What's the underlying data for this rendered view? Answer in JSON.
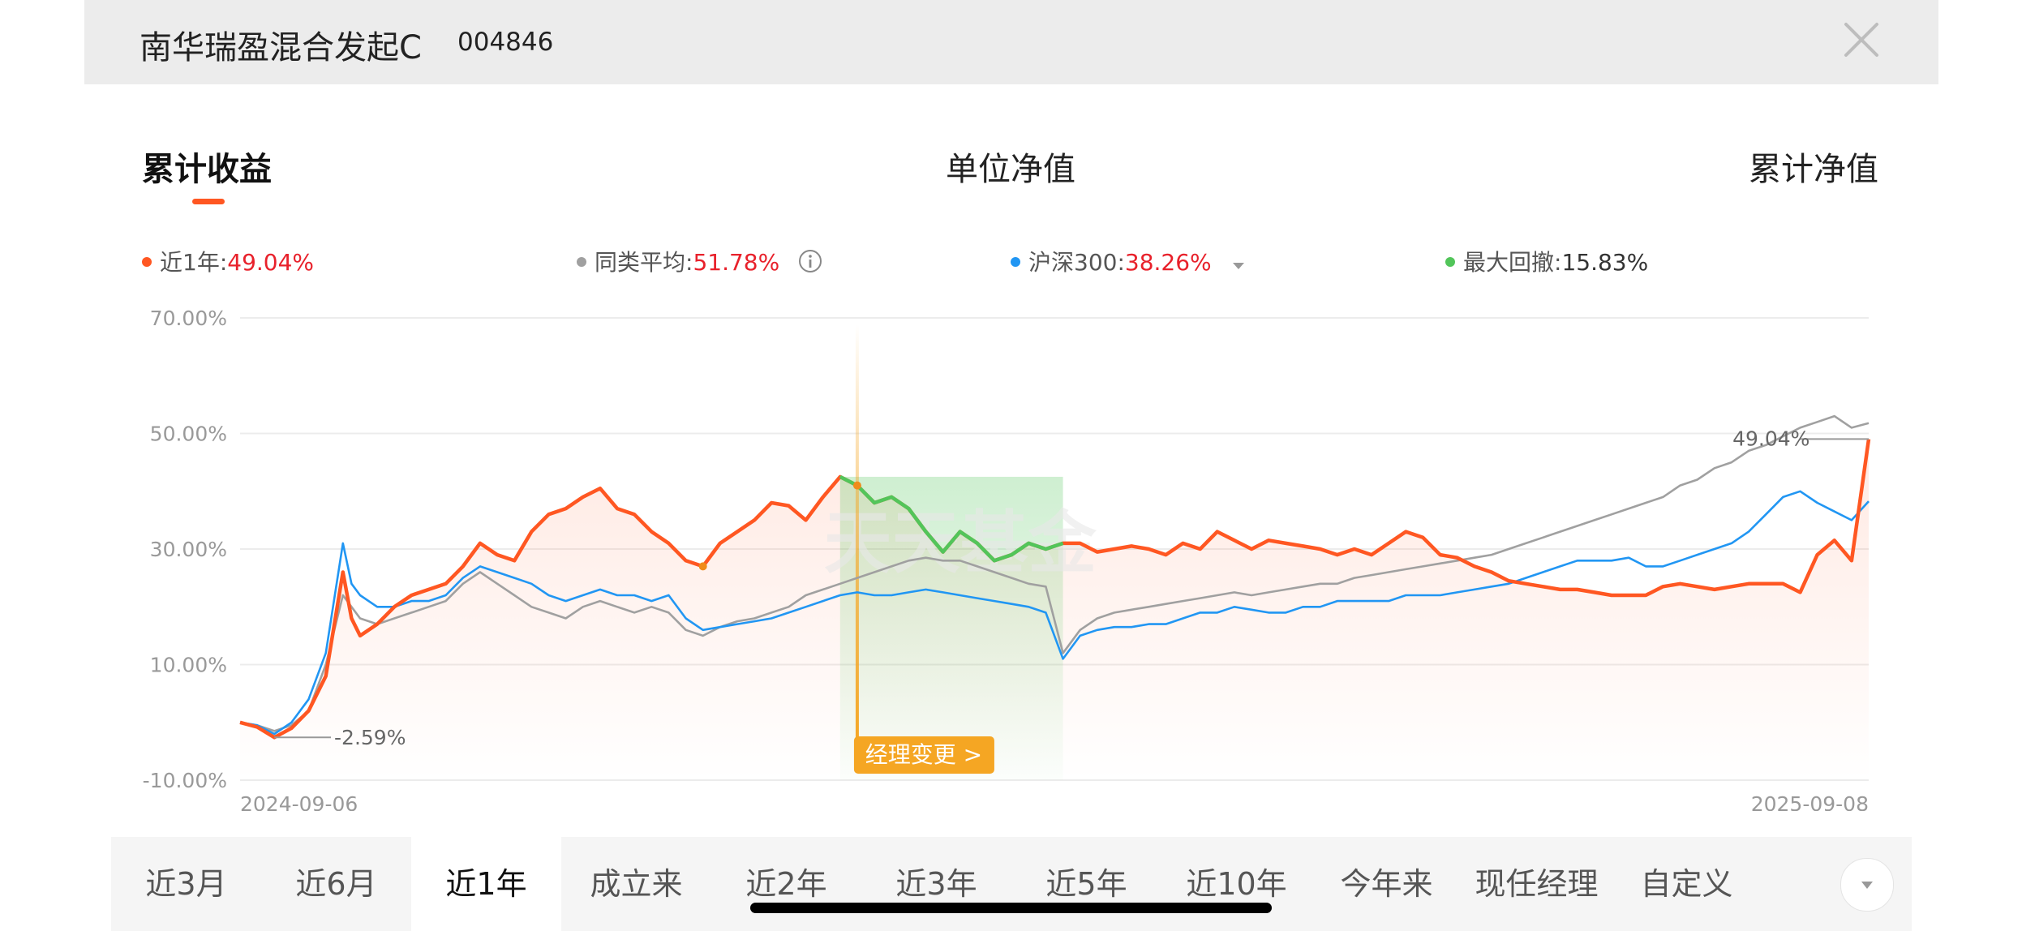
{
  "header": {
    "fund_name": "南华瑞盈混合发起C",
    "fund_code": "004846"
  },
  "tabs": [
    {
      "label": "累计收益",
      "active": true
    },
    {
      "label": "单位净值",
      "active": false
    },
    {
      "label": "累计净值",
      "active": false
    }
  ],
  "legend": [
    {
      "label": "近1年:",
      "value": "49.04%",
      "color": "#ff5722"
    },
    {
      "label": "同类平均:",
      "value": "51.78%",
      "color": "#a0a0a0"
    },
    {
      "label": "沪深300:",
      "value": "38.26%",
      "color": "#2196f3"
    },
    {
      "label": "最大回撤:",
      "value": "15.83%",
      "color": "#52c55a"
    }
  ],
  "chart_data": {
    "type": "line",
    "x_start": "2024-09-06",
    "x_end": "2025-09-08",
    "ylim": [
      -10,
      70
    ],
    "y_ticks": [
      "70.00%",
      "50.00%",
      "30.00%",
      "10.00%",
      "-10.00%"
    ],
    "x_tick_labels": [
      "2024-09-06",
      "2025-09-08"
    ],
    "grid": true,
    "series": [
      {
        "name": "近1年",
        "color": "#ff5722",
        "points": [
          [
            0,
            0
          ],
          [
            1,
            -0.8
          ],
          [
            2,
            -2.6
          ],
          [
            3,
            -1
          ],
          [
            4,
            2
          ],
          [
            5,
            8
          ],
          [
            6,
            26
          ],
          [
            6.5,
            18
          ],
          [
            7,
            15
          ],
          [
            8,
            17
          ],
          [
            9,
            20
          ],
          [
            10,
            22
          ],
          [
            11,
            23
          ],
          [
            12,
            24
          ],
          [
            13,
            27
          ],
          [
            14,
            31
          ],
          [
            15,
            29
          ],
          [
            16,
            28
          ],
          [
            17,
            33
          ],
          [
            18,
            36
          ],
          [
            19,
            37
          ],
          [
            20,
            39
          ],
          [
            21,
            40.5
          ],
          [
            22,
            37
          ],
          [
            23,
            36
          ],
          [
            24,
            33
          ],
          [
            25,
            31
          ],
          [
            26,
            28
          ],
          [
            27,
            27
          ],
          [
            28,
            31
          ],
          [
            29,
            33
          ],
          [
            30,
            35
          ],
          [
            31,
            38
          ],
          [
            32,
            37.5
          ],
          [
            33,
            35
          ],
          [
            34,
            39
          ],
          [
            35,
            42.5
          ],
          [
            36,
            41
          ],
          [
            37,
            38
          ],
          [
            38,
            39
          ],
          [
            39,
            37
          ],
          [
            40,
            33
          ],
          [
            41,
            29.5
          ],
          [
            42,
            33
          ],
          [
            43,
            31
          ],
          [
            44,
            28
          ],
          [
            45,
            29
          ],
          [
            46,
            31
          ],
          [
            47,
            30
          ],
          [
            48,
            31
          ],
          [
            49,
            31
          ],
          [
            50,
            29.5
          ],
          [
            51,
            30
          ],
          [
            52,
            30.5
          ],
          [
            53,
            30
          ],
          [
            54,
            29
          ],
          [
            55,
            31
          ],
          [
            56,
            30
          ],
          [
            57,
            33
          ],
          [
            58,
            31.5
          ],
          [
            59,
            30
          ],
          [
            60,
            31.5
          ],
          [
            61,
            31
          ],
          [
            62,
            30.5
          ],
          [
            63,
            30
          ],
          [
            64,
            29
          ],
          [
            65,
            30
          ],
          [
            66,
            29
          ],
          [
            67,
            31
          ],
          [
            68,
            33
          ],
          [
            69,
            32
          ],
          [
            70,
            29
          ],
          [
            71,
            28.5
          ],
          [
            72,
            27
          ],
          [
            73,
            26
          ],
          [
            74,
            24.5
          ],
          [
            75,
            24
          ],
          [
            76,
            23.5
          ],
          [
            77,
            23
          ],
          [
            78,
            23
          ],
          [
            79,
            22.5
          ],
          [
            80,
            22
          ],
          [
            81,
            22
          ],
          [
            82,
            22
          ],
          [
            83,
            23.5
          ],
          [
            84,
            24
          ],
          [
            85,
            23.5
          ],
          [
            86,
            23
          ],
          [
            87,
            23.5
          ],
          [
            88,
            24
          ],
          [
            89,
            24
          ],
          [
            90,
            24
          ],
          [
            91,
            22.5
          ],
          [
            92,
            29
          ],
          [
            93,
            31.5
          ],
          [
            94,
            28
          ],
          [
            95,
            49
          ]
        ]
      },
      {
        "name": "同类平均",
        "color": "#a0a0a0",
        "points": [
          [
            0,
            0
          ],
          [
            1,
            -0.5
          ],
          [
            2,
            -1.5
          ],
          [
            3,
            -0.5
          ],
          [
            4,
            2
          ],
          [
            5,
            10
          ],
          [
            6,
            22
          ],
          [
            6.5,
            20
          ],
          [
            7,
            18
          ],
          [
            8,
            17
          ],
          [
            9,
            18
          ],
          [
            10,
            19
          ],
          [
            11,
            20
          ],
          [
            12,
            21
          ],
          [
            13,
            24
          ],
          [
            14,
            26
          ],
          [
            15,
            24
          ],
          [
            16,
            22
          ],
          [
            17,
            20
          ],
          [
            18,
            19
          ],
          [
            19,
            18
          ],
          [
            20,
            20
          ],
          [
            21,
            21
          ],
          [
            22,
            20
          ],
          [
            23,
            19
          ],
          [
            24,
            20
          ],
          [
            25,
            19
          ],
          [
            26,
            16
          ],
          [
            27,
            15
          ],
          [
            28,
            16.5
          ],
          [
            29,
            17.5
          ],
          [
            30,
            18
          ],
          [
            31,
            19
          ],
          [
            32,
            20
          ],
          [
            33,
            22
          ],
          [
            34,
            23
          ],
          [
            35,
            24
          ],
          [
            36,
            25
          ],
          [
            37,
            26
          ],
          [
            38,
            27
          ],
          [
            39,
            28
          ],
          [
            40,
            28.5
          ],
          [
            41,
            28
          ],
          [
            42,
            28
          ],
          [
            43,
            27
          ],
          [
            44,
            26
          ],
          [
            45,
            25
          ],
          [
            46,
            24
          ],
          [
            47,
            23.5
          ],
          [
            48,
            12
          ],
          [
            49,
            16
          ],
          [
            50,
            18
          ],
          [
            51,
            19
          ],
          [
            52,
            19.5
          ],
          [
            53,
            20
          ],
          [
            54,
            20.5
          ],
          [
            55,
            21
          ],
          [
            56,
            21.5
          ],
          [
            57,
            22
          ],
          [
            58,
            22.5
          ],
          [
            59,
            22
          ],
          [
            60,
            22.5
          ],
          [
            61,
            23
          ],
          [
            62,
            23.5
          ],
          [
            63,
            24
          ],
          [
            64,
            24
          ],
          [
            65,
            25
          ],
          [
            66,
            25.5
          ],
          [
            67,
            26
          ],
          [
            68,
            26.5
          ],
          [
            69,
            27
          ],
          [
            70,
            27.5
          ],
          [
            71,
            28
          ],
          [
            72,
            28.5
          ],
          [
            73,
            29
          ],
          [
            74,
            30
          ],
          [
            75,
            31
          ],
          [
            76,
            32
          ],
          [
            77,
            33
          ],
          [
            78,
            34
          ],
          [
            79,
            35
          ],
          [
            80,
            36
          ],
          [
            81,
            37
          ],
          [
            82,
            38
          ],
          [
            83,
            39
          ],
          [
            84,
            41
          ],
          [
            85,
            42
          ],
          [
            86,
            44
          ],
          [
            87,
            45
          ],
          [
            88,
            47
          ],
          [
            89,
            48
          ],
          [
            90,
            49.5
          ],
          [
            91,
            51
          ],
          [
            92,
            52
          ],
          [
            93,
            53
          ],
          [
            94,
            51
          ],
          [
            95,
            51.78
          ]
        ]
      },
      {
        "name": "沪深300",
        "color": "#2196f3",
        "points": [
          [
            0,
            0
          ],
          [
            1,
            -0.5
          ],
          [
            2,
            -2
          ],
          [
            3,
            0
          ],
          [
            4,
            4
          ],
          [
            5,
            12
          ],
          [
            6,
            31
          ],
          [
            6.5,
            24
          ],
          [
            7,
            22
          ],
          [
            8,
            20
          ],
          [
            9,
            20
          ],
          [
            10,
            21
          ],
          [
            11,
            21
          ],
          [
            12,
            22
          ],
          [
            13,
            25
          ],
          [
            14,
            27
          ],
          [
            15,
            26
          ],
          [
            16,
            25
          ],
          [
            17,
            24
          ],
          [
            18,
            22
          ],
          [
            19,
            21
          ],
          [
            20,
            22
          ],
          [
            21,
            23
          ],
          [
            22,
            22
          ],
          [
            23,
            22
          ],
          [
            24,
            21
          ],
          [
            25,
            22
          ],
          [
            26,
            18
          ],
          [
            27,
            16
          ],
          [
            28,
            16.5
          ],
          [
            29,
            17
          ],
          [
            30,
            17.5
          ],
          [
            31,
            18
          ],
          [
            32,
            19
          ],
          [
            33,
            20
          ],
          [
            34,
            21
          ],
          [
            35,
            22
          ],
          [
            36,
            22.5
          ],
          [
            37,
            22
          ],
          [
            38,
            22
          ],
          [
            39,
            22.5
          ],
          [
            40,
            23
          ],
          [
            41,
            22.5
          ],
          [
            42,
            22
          ],
          [
            43,
            21.5
          ],
          [
            44,
            21
          ],
          [
            45,
            20.5
          ],
          [
            46,
            20
          ],
          [
            47,
            19
          ],
          [
            48,
            11
          ],
          [
            49,
            15
          ],
          [
            50,
            16
          ],
          [
            51,
            16.5
          ],
          [
            52,
            16.5
          ],
          [
            53,
            17
          ],
          [
            54,
            17
          ],
          [
            55,
            18
          ],
          [
            56,
            19
          ],
          [
            57,
            19
          ],
          [
            58,
            20
          ],
          [
            59,
            19.5
          ],
          [
            60,
            19
          ],
          [
            61,
            19
          ],
          [
            62,
            20
          ],
          [
            63,
            20
          ],
          [
            64,
            21
          ],
          [
            65,
            21
          ],
          [
            66,
            21
          ],
          [
            67,
            21
          ],
          [
            68,
            22
          ],
          [
            69,
            22
          ],
          [
            70,
            22
          ],
          [
            71,
            22.5
          ],
          [
            72,
            23
          ],
          [
            73,
            23.5
          ],
          [
            74,
            24
          ],
          [
            75,
            25
          ],
          [
            76,
            26
          ],
          [
            77,
            27
          ],
          [
            78,
            28
          ],
          [
            79,
            28
          ],
          [
            80,
            28
          ],
          [
            81,
            28.5
          ],
          [
            82,
            27
          ],
          [
            83,
            27
          ],
          [
            84,
            28
          ],
          [
            85,
            29
          ],
          [
            86,
            30
          ],
          [
            87,
            31
          ],
          [
            88,
            33
          ],
          [
            89,
            36
          ],
          [
            90,
            39
          ],
          [
            91,
            40
          ],
          [
            92,
            38
          ],
          [
            93,
            36.5
          ],
          [
            94,
            35
          ],
          [
            95,
            38.26
          ]
        ]
      }
    ],
    "drawdown": {
      "label": "最大回撤",
      "value": "15.83%",
      "color": "#52c55a",
      "from_x": 35,
      "to_x": 48
    },
    "annotations": {
      "end_label": "49.04%",
      "start_label": "-2.59%",
      "manager_change": {
        "label": "经理变更 >",
        "x": 36
      },
      "markers": [
        27,
        36
      ]
    }
  },
  "range_tabs": [
    {
      "label": "近3月",
      "active": false
    },
    {
      "label": "近6月",
      "active": false
    },
    {
      "label": "近1年",
      "active": true
    },
    {
      "label": "成立来",
      "active": false
    },
    {
      "label": "近2年",
      "active": false
    },
    {
      "label": "近3年",
      "active": false
    },
    {
      "label": "近5年",
      "active": false
    },
    {
      "label": "近10年",
      "active": false
    },
    {
      "label": "今年来",
      "active": false
    },
    {
      "label": "现任经理",
      "active": false
    },
    {
      "label": "自定义",
      "active": false
    }
  ]
}
